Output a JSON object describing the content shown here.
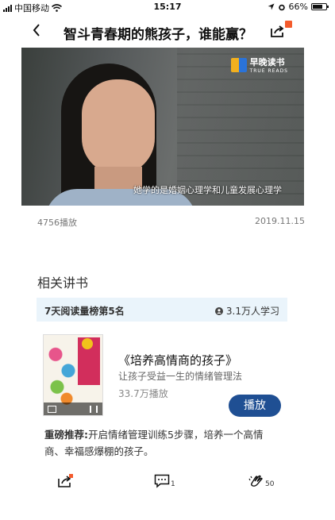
{
  "status_bar": {
    "carrier": "中国移动",
    "time": "15:17",
    "battery": "66%"
  },
  "nav": {
    "back_glyph": "‹",
    "title": "智斗青春期的熊孩子，谁能赢？"
  },
  "video": {
    "brand_name": "早晚读书",
    "brand_sub": "TRUE READS",
    "subtitle": "她学的是婚姻心理学和儿童发展心理学"
  },
  "meta": {
    "play_count": "4756播放",
    "date": "2019.11.15"
  },
  "related": {
    "section_title": "相关讲书",
    "rank_text": "7天阅读量榜第5名",
    "learners": "3.1万人学习",
    "book_title": "《培养高情商的孩子》",
    "book_desc": "让孩子受益一生的情绪管理法",
    "book_plays": "33.7万播放",
    "play_label": "播放",
    "recommend_label": "重磅推荐:",
    "recommend_text": "开启情绪管理训练5步骤，培养一个高情商、幸福感爆棚的孩子。"
  },
  "actions": {
    "comment_count": "1",
    "clap_count": "50"
  },
  "colors": {
    "accent": "#1f4f93",
    "badge": "#f45b2c",
    "card_header": "#eaf4fb"
  },
  "icons": [
    "signal-icon",
    "wifi-icon",
    "location-icon",
    "alarm-icon",
    "battery-icon",
    "back-icon",
    "share-icon",
    "comment-icon",
    "clap-icon",
    "user-icon"
  ]
}
